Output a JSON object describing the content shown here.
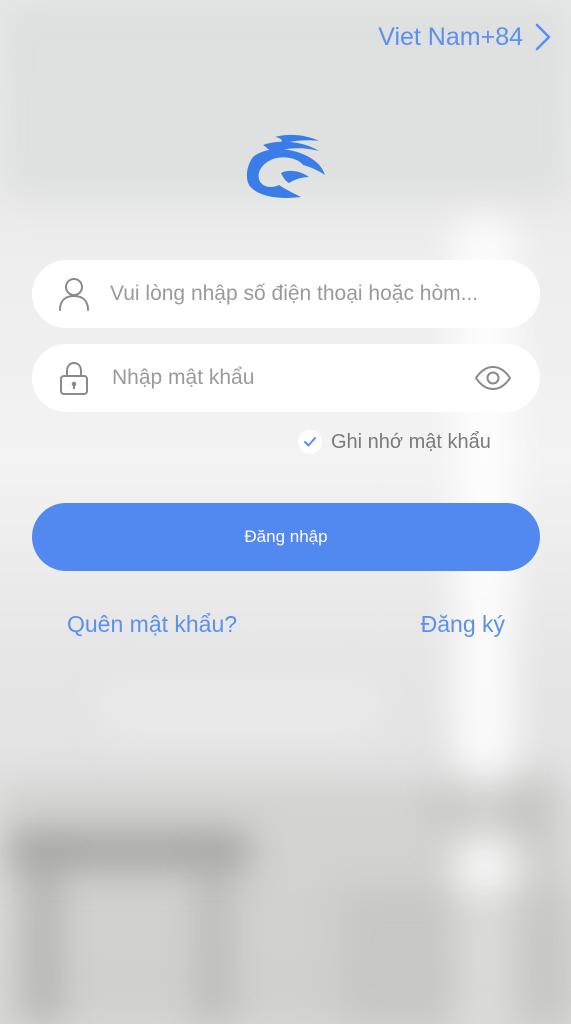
{
  "header": {
    "country_label": "Viet Nam+84",
    "chevron_icon": "chevron-right-icon"
  },
  "logo": {
    "icon": "app-logo-icon",
    "color": "#3b7de8"
  },
  "form": {
    "username_placeholder": "Vui lòng nhập số điện thoại hoặc hòm...",
    "username_value": "",
    "username_icon": "user-icon",
    "password_placeholder": "Nhập mật khẩu",
    "password_value": "",
    "password_icon": "lock-icon",
    "show_password_icon": "eye-icon",
    "remember_label": "Ghi nhớ mật khẩu",
    "remember_checked": true
  },
  "actions": {
    "login_label": "Đăng nhập",
    "forgot_label": "Quên mật khẩu?",
    "register_label": "Đăng ký"
  },
  "colors": {
    "accent": "#5289f0",
    "link": "#5b8ff0"
  }
}
